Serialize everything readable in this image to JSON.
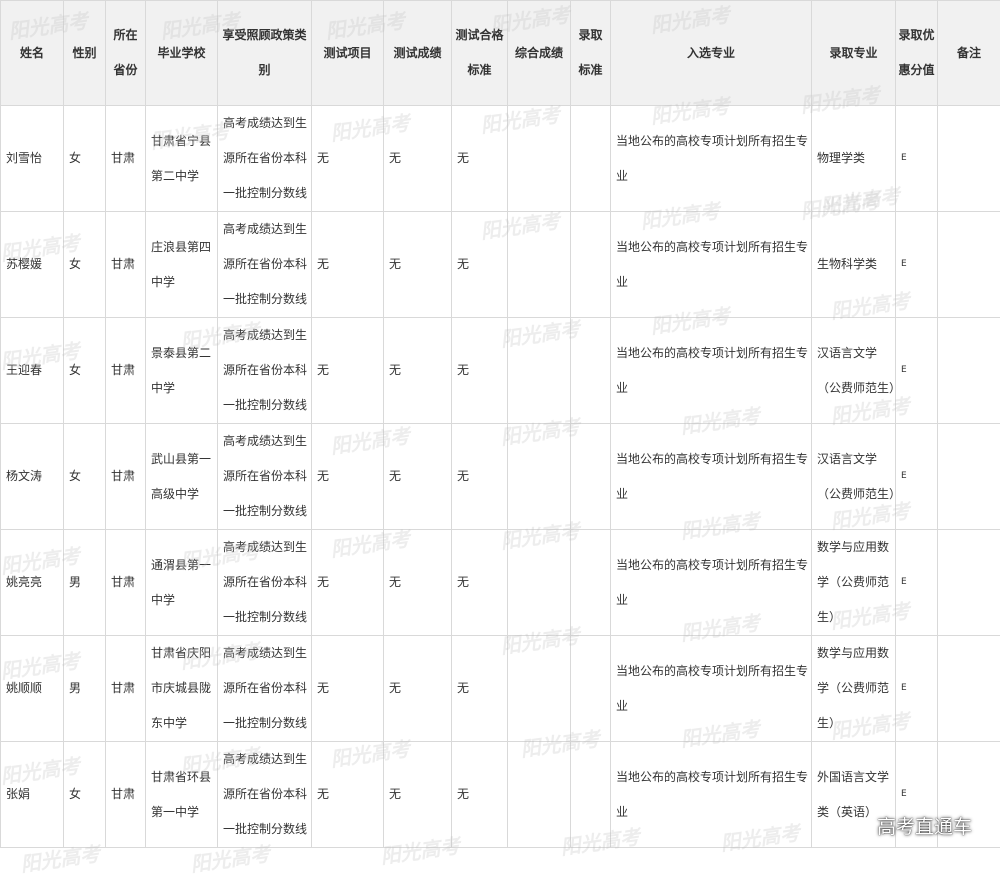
{
  "headers": [
    "姓名",
    "性别",
    "所在省份",
    "毕业学校",
    "享受照顾政策类别",
    "测试项目",
    "测试成绩",
    "测试合格标准",
    "综合成绩",
    "录取标准",
    "入选专业",
    "录取专业",
    "录取优惠分值",
    "备注"
  ],
  "rows": [
    {
      "name": "刘雪怡",
      "gender": "女",
      "province": "甘肃",
      "school": "甘肃省宁县第二中学",
      "policy": "高考成绩达到生源所在省份本科一批控制分数线",
      "test_item": "无",
      "test_score": "无",
      "test_standard": "无",
      "composite_score": "",
      "admission_standard": "",
      "selected_major": "当地公布的高校专项计划所有招生专业",
      "admitted_major": "物理学类",
      "bonus_points": "E",
      "remarks": ""
    },
    {
      "name": "苏樱媛",
      "gender": "女",
      "province": "甘肃",
      "school": "庄浪县第四中学",
      "policy": "高考成绩达到生源所在省份本科一批控制分数线",
      "test_item": "无",
      "test_score": "无",
      "test_standard": "无",
      "composite_score": "",
      "admission_standard": "",
      "selected_major": "当地公布的高校专项计划所有招生专业",
      "admitted_major": "生物科学类",
      "bonus_points": "E",
      "remarks": ""
    },
    {
      "name": "王迎春",
      "gender": "女",
      "province": "甘肃",
      "school": "景泰县第二中学",
      "policy": "高考成绩达到生源所在省份本科一批控制分数线",
      "test_item": "无",
      "test_score": "无",
      "test_standard": "无",
      "composite_score": "",
      "admission_standard": "",
      "selected_major": "当地公布的高校专项计划所有招生专业",
      "admitted_major": "汉语言文学（公费师范生）",
      "bonus_points": "E",
      "remarks": ""
    },
    {
      "name": "杨文涛",
      "gender": "女",
      "province": "甘肃",
      "school": "武山县第一高级中学",
      "policy": "高考成绩达到生源所在省份本科一批控制分数线",
      "test_item": "无",
      "test_score": "无",
      "test_standard": "无",
      "composite_score": "",
      "admission_standard": "",
      "selected_major": "当地公布的高校专项计划所有招生专业",
      "admitted_major": "汉语言文学（公费师范生）",
      "bonus_points": "E",
      "remarks": ""
    },
    {
      "name": "姚亮亮",
      "gender": "男",
      "province": "甘肃",
      "school": "通渭县第一中学",
      "policy": "高考成绩达到生源所在省份本科一批控制分数线",
      "test_item": "无",
      "test_score": "无",
      "test_standard": "无",
      "composite_score": "",
      "admission_standard": "",
      "selected_major": "当地公布的高校专项计划所有招生专业",
      "admitted_major": "数学与应用数学（公费师范生）",
      "bonus_points": "E",
      "remarks": ""
    },
    {
      "name": "姚顺顺",
      "gender": "男",
      "province": "甘肃",
      "school": "甘肃省庆阳市庆城县陇东中学",
      "policy": "高考成绩达到生源所在省份本科一批控制分数线",
      "test_item": "无",
      "test_score": "无",
      "test_standard": "无",
      "composite_score": "",
      "admission_standard": "",
      "selected_major": "当地公布的高校专项计划所有招生专业",
      "admitted_major": "数学与应用数学（公费师范生）",
      "bonus_points": "E",
      "remarks": ""
    },
    {
      "name": "张娟",
      "gender": "女",
      "province": "甘肃",
      "school": "甘肃省环县第一中学",
      "policy": "高考成绩达到生源所在省份本科一批控制分数线",
      "test_item": "无",
      "test_score": "无",
      "test_standard": "无",
      "composite_score": "",
      "admission_standard": "",
      "selected_major": "当地公布的高校专项计划所有招生专业",
      "admitted_major": "外国语言文学类（英语）",
      "bonus_points": "E",
      "remarks": ""
    }
  ],
  "watermark": "阳光高考",
  "brand": "高考直通车"
}
